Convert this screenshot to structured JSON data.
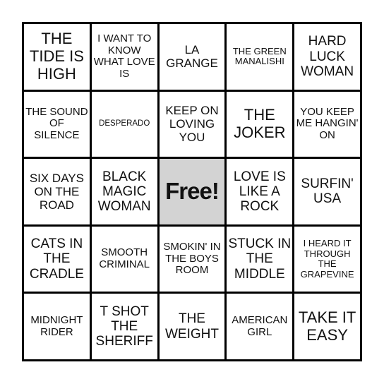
{
  "board": {
    "free_label": "Free!",
    "colors": {
      "free_cell": "#d3d3d3",
      "grid_line": "#000000",
      "cell": "#ffffff"
    },
    "rows": [
      [
        "THE TIDE IS HIGH",
        "I WANT TO KNOW WHAT LOVE IS",
        "LA GRANGE",
        "THE GREEN MANALISHI",
        "HARD LUCK WOMAN"
      ],
      [
        "THE SOUND OF SILENCE",
        "DESPERADO",
        "KEEP ON LOVING YOU",
        "THE JOKER",
        "YOU KEEP ME HANGIN' ON"
      ],
      [
        "SIX DAYS ON THE ROAD",
        "BLACK MAGIC WOMAN",
        "Free!",
        "LOVE IS LIKE A ROCK",
        "SURFIN' USA"
      ],
      [
        "CATS IN THE CRADLE",
        "SMOOTH CRIMINAL",
        "SMOKIN' IN THE BOYS ROOM",
        "STUCK IN THE MIDDLE",
        "I HEARD IT THROUGH THE GRAPEVINE"
      ],
      [
        "MIDNIGHT RIDER",
        "T SHOT THE SHERIFF",
        "THE WEIGHT",
        "AMERICAN GIRL",
        "TAKE IT EASY"
      ]
    ]
  }
}
